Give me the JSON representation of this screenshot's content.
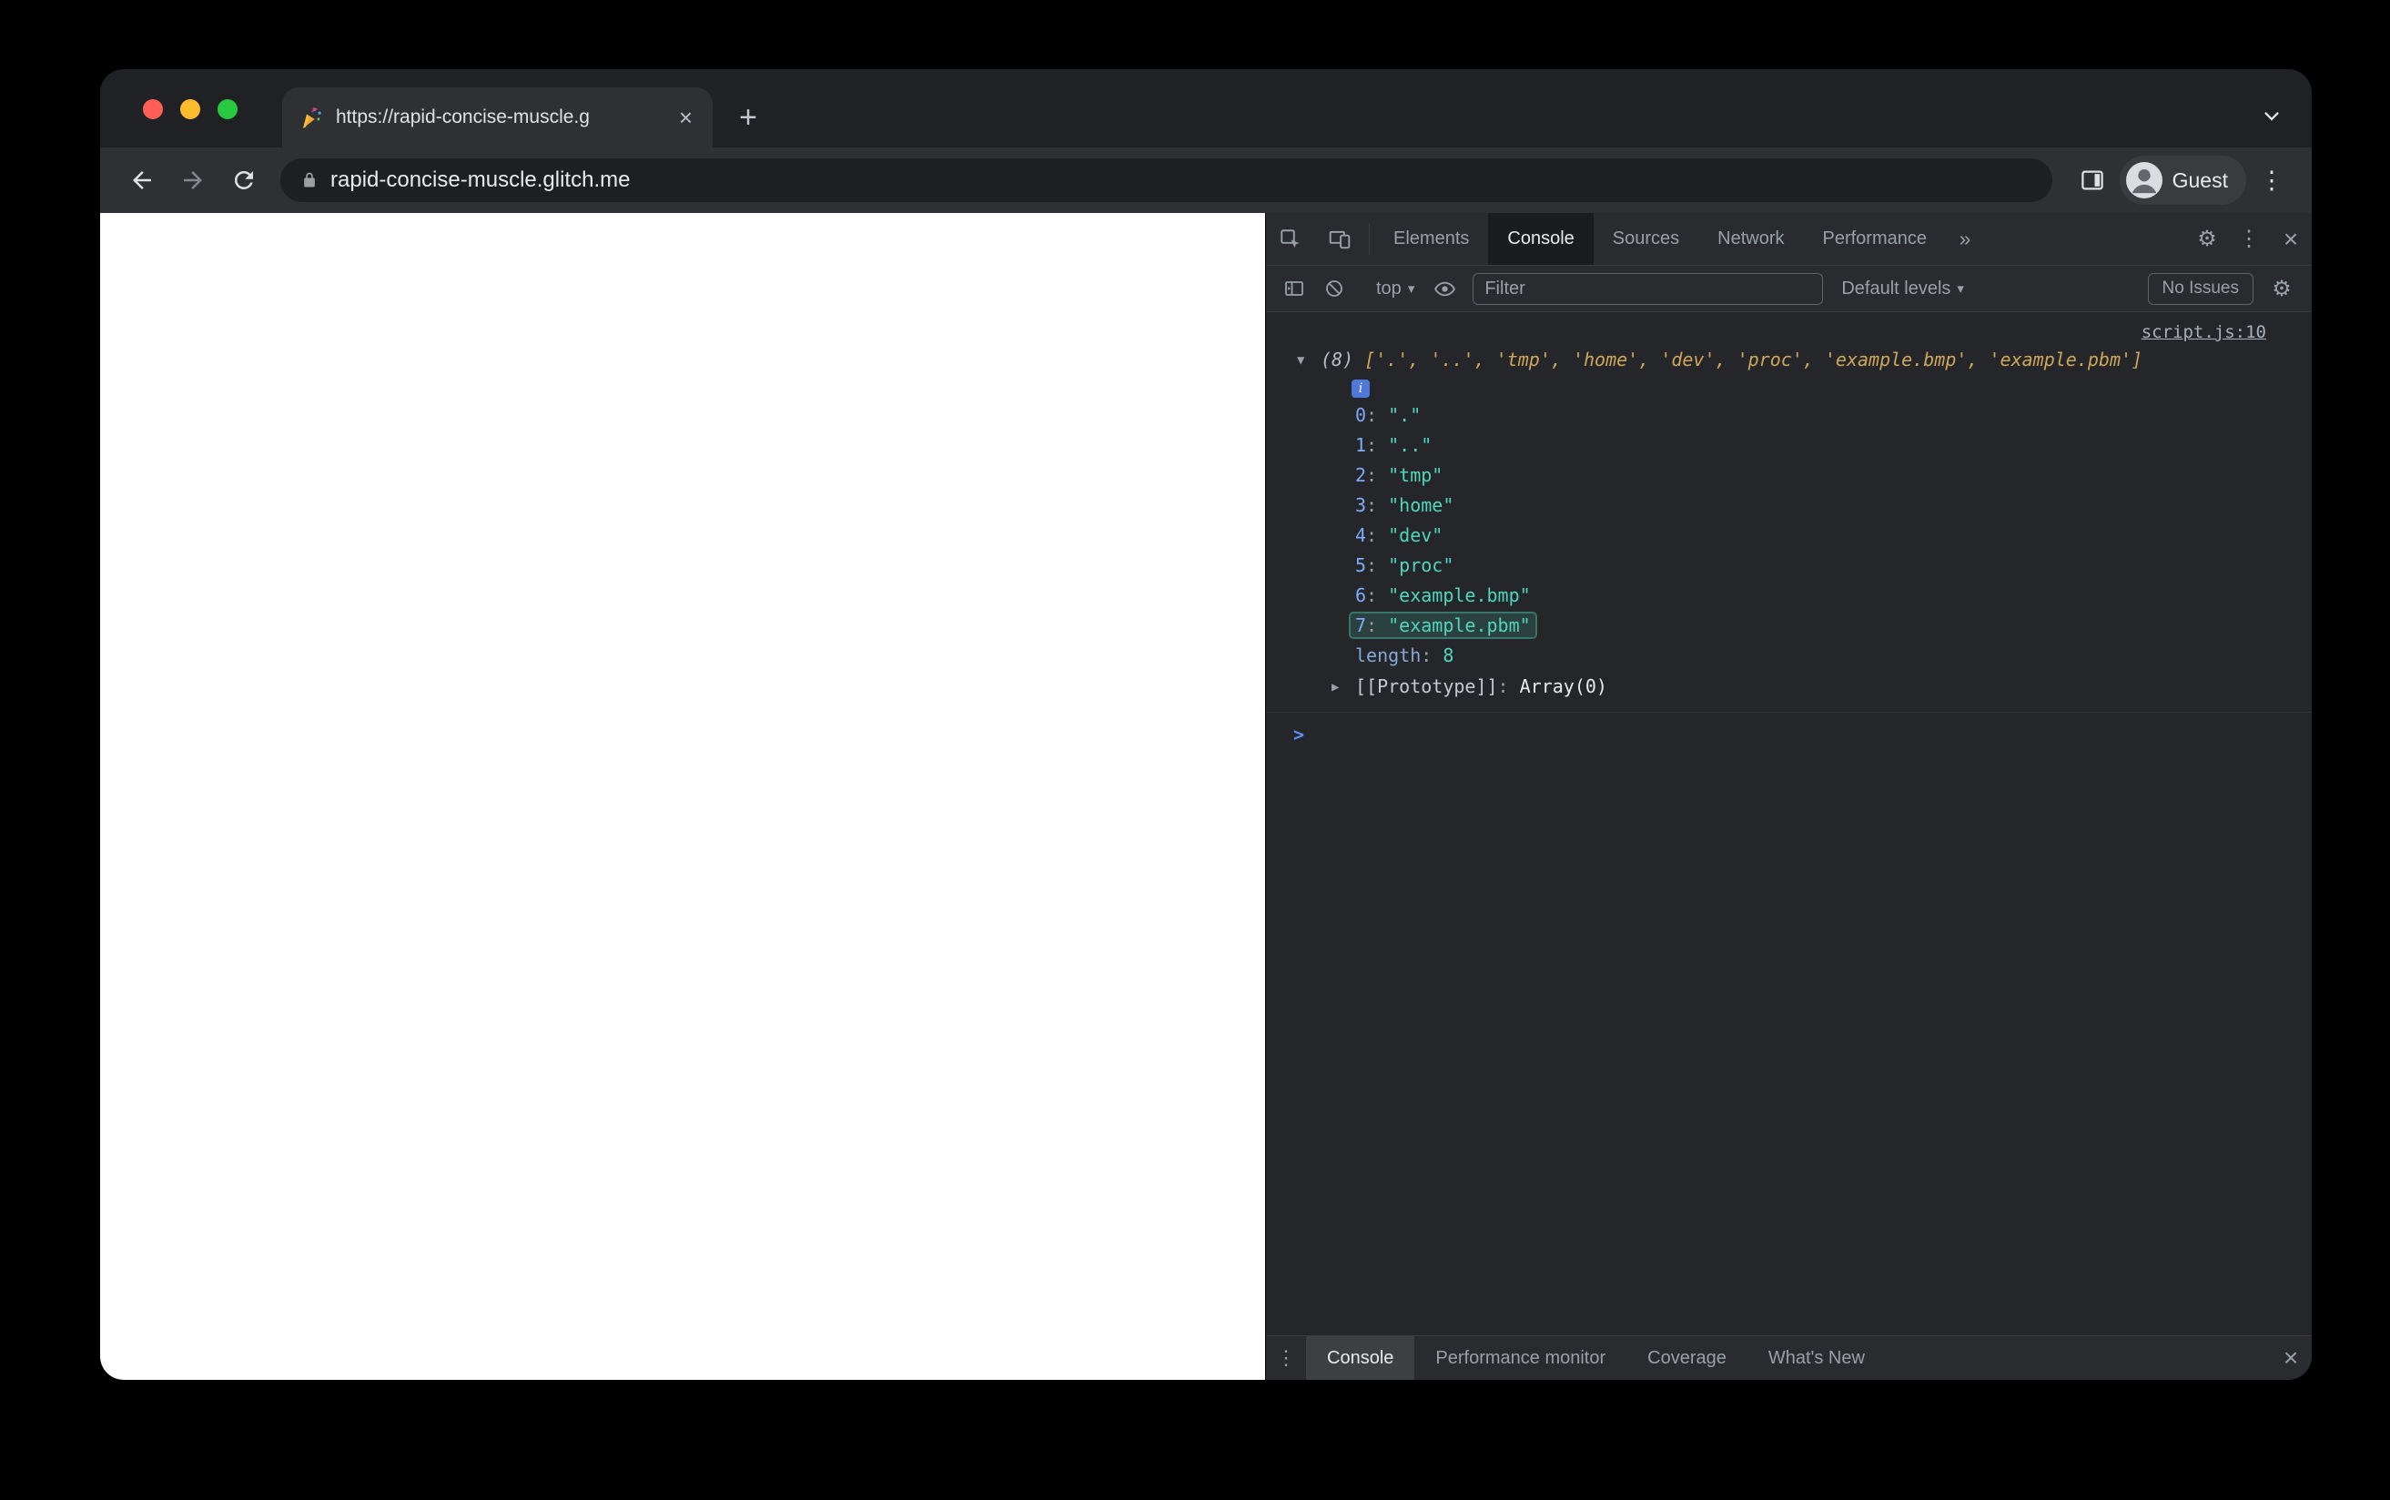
{
  "browser": {
    "tab_title": "https://rapid-concise-muscle.g",
    "tab_close_glyph": "×",
    "new_tab_glyph": "+",
    "address": "rapid-concise-muscle.glitch.me",
    "profile_label": "Guest",
    "menu_glyph": "⋮"
  },
  "devtools": {
    "tabs": [
      "Elements",
      "Console",
      "Sources",
      "Network",
      "Performance"
    ],
    "selected_tab": "Console",
    "overflow_glyph": "»",
    "gear_glyph": "⚙",
    "menu_glyph": "⋮",
    "close_glyph": "×",
    "toolbar": {
      "context_label": "top",
      "caret": "▾",
      "filter_placeholder": "Filter",
      "levels_label": "Default levels",
      "no_issues_label": "No Issues"
    },
    "console": {
      "source_link": "script.js:10",
      "twirl_open": "▼",
      "twirl_closed": "▶",
      "count": "(8)",
      "preview": "['.', '..', 'tmp', 'home', 'dev', 'proc', 'example.bmp', 'example.pbm']",
      "info_glyph": "i",
      "colon": ": ",
      "items": [
        {
          "key": "0",
          "value": "\".\""
        },
        {
          "key": "1",
          "value": "\"..\""
        },
        {
          "key": "2",
          "value": "\"tmp\""
        },
        {
          "key": "3",
          "value": "\"home\""
        },
        {
          "key": "4",
          "value": "\"dev\""
        },
        {
          "key": "5",
          "value": "\"proc\""
        },
        {
          "key": "6",
          "value": "\"example.bmp\""
        },
        {
          "key": "7",
          "value": "\"example.pbm\""
        }
      ],
      "length_key": "length",
      "length_value": "8",
      "prototype_key": "[[Prototype]]",
      "prototype_value": "Array(0)",
      "prompt": ">"
    },
    "drawer": {
      "tabs": [
        "Console",
        "Performance monitor",
        "Coverage",
        "What's New"
      ],
      "selected": "Console",
      "menu_glyph": "⋮",
      "close_glyph": "×"
    }
  },
  "colors": {
    "traffic_red": "#ff5f57",
    "traffic_yellow": "#febc2e",
    "traffic_green": "#28c840",
    "key_blue": "#7cacf8",
    "string_teal": "#4fd6bc",
    "preview_tan": "#cfa75a",
    "prompt_blue": "#588ef8",
    "devtools_bg": "#242629",
    "devtools_bar": "#292b2e",
    "browser_toolbar": "#2e3033",
    "tabstrip_bg": "#202124"
  }
}
